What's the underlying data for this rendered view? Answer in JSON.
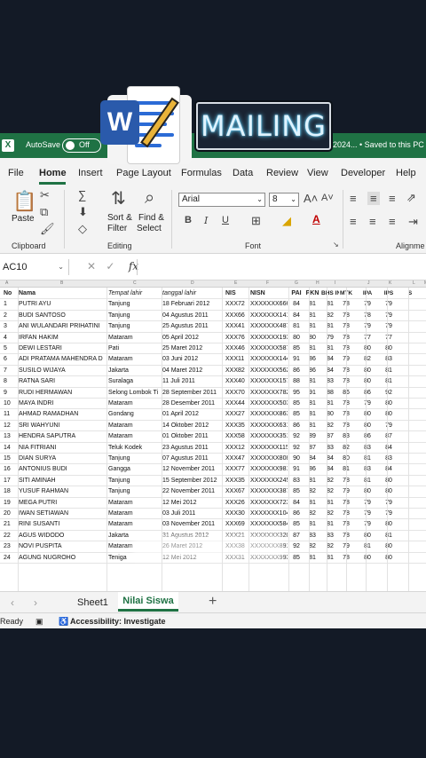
{
  "titlebar": {
    "logo": "X",
    "autosave": "AutoSave",
    "toggle": "Off",
    "file_status": "-2024... • Saved to this PC"
  },
  "banner": {
    "word_letter": "W",
    "text": "MAILING"
  },
  "tabs": [
    "File",
    "Home",
    "Insert",
    "Page Layout",
    "Formulas",
    "Data",
    "Review",
    "View",
    "Developer",
    "Help"
  ],
  "ribbon": {
    "paste": "Paste",
    "clipboard": "Clipboard",
    "sort_filter_1": "Sort &",
    "sort_filter_2": "Filter",
    "find_select_1": "Find &",
    "find_select_2": "Select",
    "editing": "Editing",
    "font_name": "Arial",
    "font_size": "8",
    "font_group": "Font",
    "alignment": "Alignme"
  },
  "formula_bar": {
    "name_box": "AC10",
    "fx": "fx"
  },
  "columns_letters": [
    "A",
    "B",
    "C",
    "D",
    "E",
    "F",
    "G",
    "H",
    "I",
    "J",
    "K",
    "L",
    "M"
  ],
  "table": {
    "headers": [
      "No",
      "Nama",
      "Tempat lahir",
      "tanggal lahir",
      "NIS",
      "NISN",
      "PAI",
      "PKN",
      "BHS INDO",
      "MTK",
      "IPA",
      "IPS",
      "S"
    ],
    "rows": [
      [
        "1",
        "PUTRI AYU",
        "Tanjung",
        "18 Februari 2012",
        "XXX72",
        "XXXXXXX666",
        "84",
        "81",
        "81",
        "78",
        "79",
        "79"
      ],
      [
        "2",
        "BUDI SANTOSO",
        "Tanjung",
        "04 Agustus 2011",
        "XXX66",
        "XXXXXXX141",
        "84",
        "81",
        "82",
        "78",
        "78",
        "79"
      ],
      [
        "3",
        "ANI WULANDARI PRIHATINI",
        "Tanjung",
        "25 Agustus 2011",
        "XXX41",
        "XXXXXXX487",
        "81",
        "81",
        "81",
        "78",
        "79",
        "79"
      ],
      [
        "4",
        "IRFAN HAKIM",
        "Mataram",
        "05 April 2012",
        "XXX76",
        "XXXXXXX193",
        "80",
        "80",
        "79",
        "78",
        "77",
        "77"
      ],
      [
        "5",
        "DEWI LESTARI",
        "Pati",
        "25 Maret 2012",
        "XXX46",
        "XXXXXXX587",
        "85",
        "81",
        "81",
        "78",
        "80",
        "80"
      ],
      [
        "6",
        "ADI PRATAMA MAHENDRA D",
        "Mataram",
        "03 Juni 2012",
        "XXX11",
        "XXXXXXX144",
        "91",
        "86",
        "84",
        "79",
        "82",
        "83"
      ],
      [
        "7",
        "SUSILO WIJAYA",
        "Jakarta",
        "04 Maret 2012",
        "XXX82",
        "XXXXXXX562",
        "86",
        "86",
        "84",
        "78",
        "80",
        "81"
      ],
      [
        "8",
        "RATNA SARI",
        "Suralaga",
        "11 Juli 2011",
        "XXX40",
        "XXXXXXX157",
        "88",
        "81",
        "83",
        "78",
        "80",
        "81"
      ],
      [
        "9",
        "RUDI HERMAWAN",
        "Selong Lombok Ti",
        "28 September 2011",
        "XXX70",
        "XXXXXXX782",
        "95",
        "91",
        "88",
        "86",
        "86",
        "92"
      ],
      [
        "10",
        "MAYA INDRI",
        "Mataram",
        "28 Desember 2011",
        "XXX44",
        "XXXXXXX503",
        "85",
        "81",
        "81",
        "78",
        "79",
        "80"
      ],
      [
        "11",
        "AHMAD RAMADHAN",
        "Gondang",
        "01 April 2012",
        "XXX27",
        "XXXXXXX863",
        "85",
        "81",
        "80",
        "78",
        "80",
        "80"
      ],
      [
        "12",
        "SRI WAHYUNI",
        "Mataram",
        "14 Oktober 2012",
        "XXX35",
        "XXXXXXX631",
        "86",
        "81",
        "82",
        "78",
        "80",
        "79"
      ],
      [
        "13",
        "HENDRA SAPUTRA",
        "Mataram",
        "01 Oktober 2011",
        "XXX58",
        "XXXXXXX351",
        "92",
        "89",
        "87",
        "83",
        "86",
        "87"
      ],
      [
        "14",
        "NIA FITRIANI",
        "Teluk Kodek",
        "23 Agustus 2011",
        "XXX12",
        "XXXXXXX115",
        "92",
        "87",
        "83",
        "82",
        "83",
        "84"
      ],
      [
        "15",
        "DIAN SURYA",
        "Tanjung",
        "07 Agustus 2011",
        "XXX47",
        "XXXXXXX808",
        "90",
        "84",
        "84",
        "80",
        "81",
        "83"
      ],
      [
        "16",
        "ANTONIUS BUDI",
        "Gangga",
        "12 November 2011",
        "XXX77",
        "XXXXXXX981",
        "91",
        "86",
        "84",
        "81",
        "83",
        "84"
      ],
      [
        "17",
        "SITI AMINAH",
        "Tanjung",
        "15 September 2012",
        "XXX35",
        "XXXXXXX245",
        "83",
        "81",
        "82",
        "78",
        "81",
        "80"
      ],
      [
        "18",
        "YUSUF RAHMAN",
        "Tanjung",
        "22 November 2011",
        "XXX67",
        "XXXXXXX387",
        "85",
        "82",
        "82",
        "79",
        "80",
        "80"
      ],
      [
        "19",
        "MEGA PUTRI",
        "Mataram",
        "12 Mei 2012",
        "XXX26",
        "XXXXXXX723",
        "84",
        "81",
        "81",
        "78",
        "79",
        "79"
      ],
      [
        "20",
        "IWAN SETIAWAN",
        "Mataram",
        "03 Juli 2011",
        "XXX30",
        "XXXXXXX104",
        "86",
        "82",
        "82",
        "78",
        "79",
        "79"
      ],
      [
        "21",
        "RINI SUSANTI",
        "Mataram",
        "03 November 2011",
        "XXX69",
        "XXXXXXX584",
        "85",
        "81",
        "81",
        "78",
        "79",
        "80"
      ],
      [
        "22",
        "AGUS WIDODO",
        "Jakarta",
        "31 Agustus 2012",
        "XXX21",
        "XXXXXXX320",
        "87",
        "83",
        "83",
        "78",
        "80",
        "81"
      ],
      [
        "23",
        "NOVI PUSPITA",
        "Mataram",
        "26 Maret 2012",
        "XXX38",
        "XXXXXXX891",
        "92",
        "82",
        "82",
        "79",
        "81",
        "80"
      ],
      [
        "24",
        "AGUNG NUGROHO",
        "Teniga",
        "12 Mei 2012",
        "XXX31",
        "XXXXXXX993",
        "85",
        "81",
        "81",
        "78",
        "80",
        "80"
      ]
    ]
  },
  "sheets": {
    "sheet1": "Sheet1",
    "active": "Nilai Siswa",
    "add": "+"
  },
  "status": {
    "ready": "Ready",
    "accessibility": "Accessibility: Investigate"
  }
}
